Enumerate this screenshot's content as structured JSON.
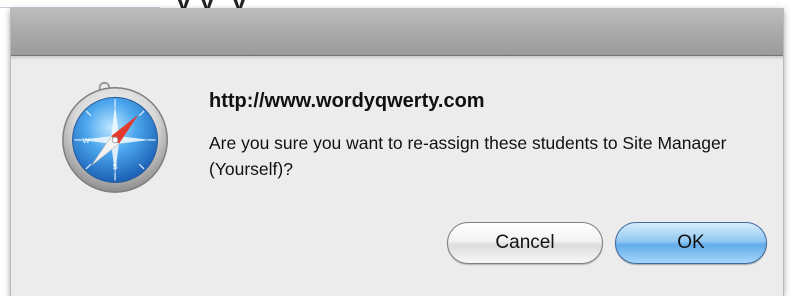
{
  "background": {
    "page_text": "’y’y  ’y"
  },
  "dialog": {
    "url": "http://www.wordyqwerty.com",
    "message": "Are you sure you want to re-assign these students to Site Manager (Yourself)?",
    "icon": "safari-compass-icon",
    "buttons": {
      "cancel_label": "Cancel",
      "ok_label": "OK"
    },
    "colors": {
      "sheet_background": "#ececec",
      "default_button": "#63acea"
    }
  }
}
